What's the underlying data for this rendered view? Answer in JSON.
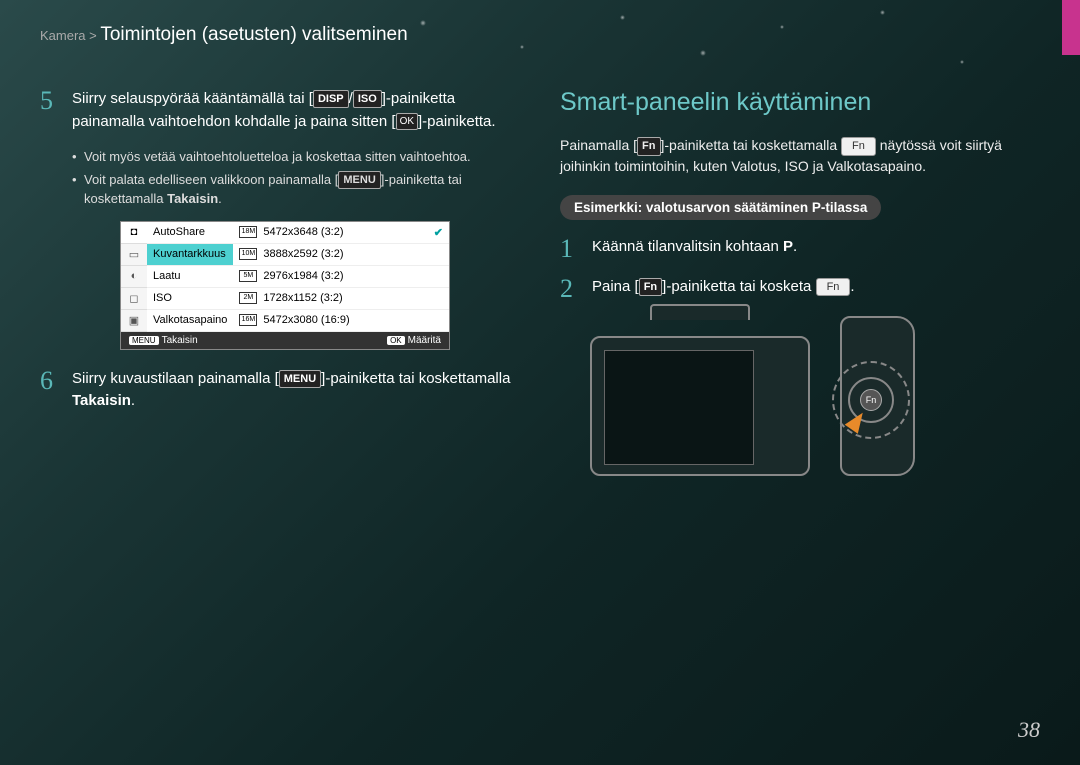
{
  "header": {
    "breadcrumb_prefix": "Kamera > ",
    "breadcrumb_title": "Toimintojen (asetusten) valitseminen"
  },
  "left": {
    "step5_num": "5",
    "step5_text_a": "Siirry selauspyörää kääntämällä tai [",
    "step5_disp": "DISP",
    "step5_slash": "/",
    "step5_iso": "ISO",
    "step5_text_b": "]-painiketta painamalla vaihtoehdon kohdalle ja paina sitten [",
    "step5_ok": "OK",
    "step5_text_c": "]-painiketta.",
    "bullet1": "Voit myös vetää vaihtoehtoluetteloa ja koskettaa sitten vaihtoehtoa.",
    "bullet2_a": "Voit palata edelliseen valikkoon painamalla [",
    "bullet2_menu": "MENU",
    "bullet2_b": "]-painiketta tai koskettamalla ",
    "bullet2_bold": "Takaisin",
    "bullet2_c": ".",
    "menu": {
      "left_items": [
        "AutoShare",
        "Kuvantarkkuus",
        "Laatu",
        "ISO",
        "Valkotasapaino"
      ],
      "right_items": [
        {
          "icon": "18M",
          "label": "5472x3648 (3:2)",
          "checked": true
        },
        {
          "icon": "10M",
          "label": "3888x2592 (3:2)",
          "checked": false
        },
        {
          "icon": "5M",
          "label": "2976x1984 (3:2)",
          "checked": false
        },
        {
          "icon": "2M",
          "label": "1728x1152 (3:2)",
          "checked": false
        },
        {
          "icon": "16M",
          "label": "5472x3080 (16:9)",
          "checked": false
        }
      ],
      "footer_left_btn": "MENU",
      "footer_left": "Takaisin",
      "footer_right_btn": "OK",
      "footer_right": "Määritä"
    },
    "step6_num": "6",
    "step6_text_a": "Siirry kuvaustilaan painamalla [",
    "step6_menu": "MENU",
    "step6_text_b": "]-painiketta tai koskettamalla ",
    "step6_bold": "Takaisin",
    "step6_text_c": "."
  },
  "right": {
    "title": "Smart-paneelin käyttäminen",
    "para_a": "Painamalla [",
    "para_fn1": "Fn",
    "para_b": "]-painiketta tai koskettamalla ",
    "para_fnbtn": "Fn",
    "para_c": " näytössä voit siirtyä joihinkin toimintoihin, kuten Valotus, ISO ja Valkotasapaino.",
    "pill_a": "Esimerkki: valotusarvon säätäminen ",
    "pill_p": "P",
    "pill_b": "-tilassa",
    "step1_num": "1",
    "step1_a": "Käännä tilanvalitsin kohtaan ",
    "step1_p": "P",
    "step1_b": ".",
    "step2_num": "2",
    "step2_a": "Paina [",
    "step2_fn": "Fn",
    "step2_b": "]-painiketta tai kosketa ",
    "step2_fnbtn": "Fn",
    "step2_c": ".",
    "camera_fn": "Fn"
  },
  "page_number": "38"
}
